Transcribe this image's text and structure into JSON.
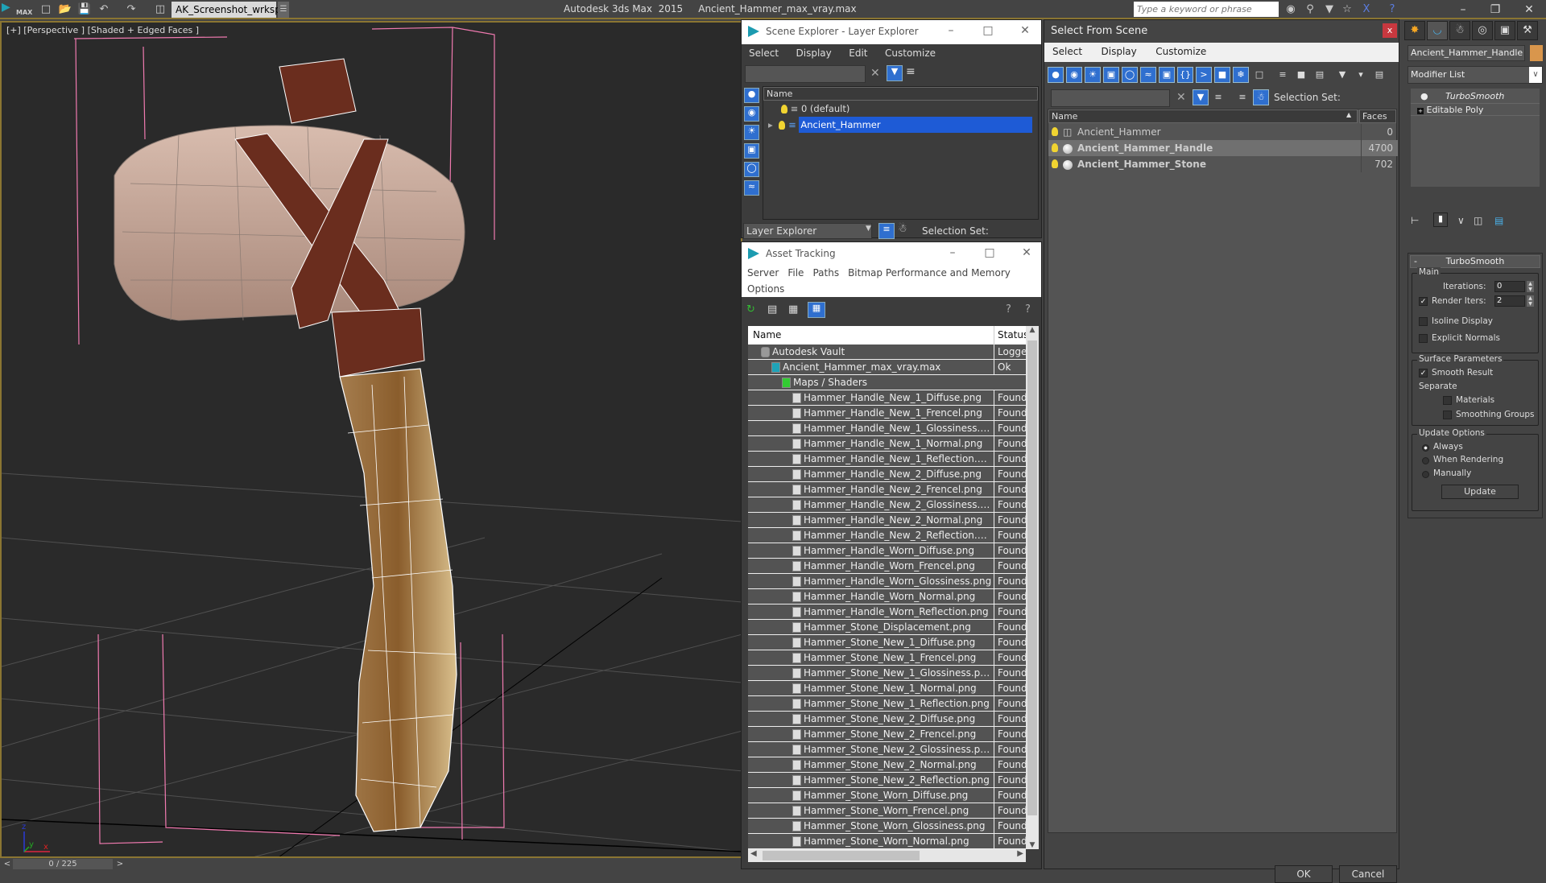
{
  "app": {
    "logo": "MAX",
    "workspace": "AK_Screenshot_wrksp",
    "title": "Autodesk 3ds Max  2015     Ancient_Hammer_max_vray.max",
    "search_placeholder": "Type a keyword or phrase"
  },
  "viewport": {
    "label": "[+] [Perspective ] [Shaded + Edged Faces ]",
    "axis": {
      "x": "x",
      "y": "y",
      "z": "z"
    },
    "timeslider": "0 / 225",
    "prev": "<",
    "next": ">"
  },
  "scene_explorer": {
    "title": "Scene Explorer - Layer Explorer",
    "menu": [
      "Select",
      "Display",
      "Edit",
      "Customize"
    ],
    "column": "Name",
    "layers": [
      {
        "name": "0 (default)",
        "selected": false
      },
      {
        "name": "Ancient_Hammer",
        "selected": true
      }
    ],
    "footer_dropdown": "Layer Explorer",
    "selection_set_label": "Selection Set:"
  },
  "asset_tracking": {
    "title": "Asset Tracking",
    "menu": [
      "Server",
      "File",
      "Paths",
      "Bitmap Performance and Memory",
      "Options"
    ],
    "columns": {
      "name": "Name",
      "status": "Status"
    },
    "rows": [
      {
        "name": "Autodesk Vault",
        "status": "Logged",
        "level": 0,
        "icon": "vault-icon"
      },
      {
        "name": "Ancient_Hammer_max_vray.max",
        "status": "Ok",
        "level": 1,
        "icon": "max-file-icon"
      },
      {
        "name": "Maps / Shaders",
        "status": "",
        "level": 2,
        "icon": "maps-folder-icon"
      },
      {
        "name": "Hammer_Handle_New_1_Diffuse.png",
        "status": "Found",
        "level": 3
      },
      {
        "name": "Hammer_Handle_New_1_Frencel.png",
        "status": "Found",
        "level": 3
      },
      {
        "name": "Hammer_Handle_New_1_Glossiness.p...",
        "status": "Found",
        "level": 3
      },
      {
        "name": "Hammer_Handle_New_1_Normal.png",
        "status": "Found",
        "level": 3
      },
      {
        "name": "Hammer_Handle_New_1_Reflection.p...",
        "status": "Found",
        "level": 3
      },
      {
        "name": "Hammer_Handle_New_2_Diffuse.png",
        "status": "Found",
        "level": 3
      },
      {
        "name": "Hammer_Handle_New_2_Frencel.png",
        "status": "Found",
        "level": 3
      },
      {
        "name": "Hammer_Handle_New_2_Glossiness.p...",
        "status": "Found",
        "level": 3
      },
      {
        "name": "Hammer_Handle_New_2_Normal.png",
        "status": "Found",
        "level": 3
      },
      {
        "name": "Hammer_Handle_New_2_Reflection.p...",
        "status": "Found",
        "level": 3
      },
      {
        "name": "Hammer_Handle_Worn_Diffuse.png",
        "status": "Found",
        "level": 3
      },
      {
        "name": "Hammer_Handle_Worn_Frencel.png",
        "status": "Found",
        "level": 3
      },
      {
        "name": "Hammer_Handle_Worn_Glossiness.png",
        "status": "Found",
        "level": 3
      },
      {
        "name": "Hammer_Handle_Worn_Normal.png",
        "status": "Found",
        "level": 3
      },
      {
        "name": "Hammer_Handle_Worn_Reflection.png",
        "status": "Found",
        "level": 3
      },
      {
        "name": "Hammer_Stone_Displacement.png",
        "status": "Found",
        "level": 3
      },
      {
        "name": "Hammer_Stone_New_1_Diffuse.png",
        "status": "Found",
        "level": 3
      },
      {
        "name": "Hammer_Stone_New_1_Frencel.png",
        "status": "Found",
        "level": 3
      },
      {
        "name": "Hammer_Stone_New_1_Glossiness.png",
        "status": "Found",
        "level": 3
      },
      {
        "name": "Hammer_Stone_New_1_Normal.png",
        "status": "Found",
        "level": 3
      },
      {
        "name": "Hammer_Stone_New_1_Reflection.png",
        "status": "Found",
        "level": 3
      },
      {
        "name": "Hammer_Stone_New_2_Diffuse.png",
        "status": "Found",
        "level": 3
      },
      {
        "name": "Hammer_Stone_New_2_Frencel.png",
        "status": "Found",
        "level": 3
      },
      {
        "name": "Hammer_Stone_New_2_Glossiness.png",
        "status": "Found",
        "level": 3
      },
      {
        "name": "Hammer_Stone_New_2_Normal.png",
        "status": "Found",
        "level": 3
      },
      {
        "name": "Hammer_Stone_New_2_Reflection.png",
        "status": "Found",
        "level": 3
      },
      {
        "name": "Hammer_Stone_Worn_Diffuse.png",
        "status": "Found",
        "level": 3
      },
      {
        "name": "Hammer_Stone_Worn_Frencel.png",
        "status": "Found",
        "level": 3
      },
      {
        "name": "Hammer_Stone_Worn_Glossiness.png",
        "status": "Found",
        "level": 3
      },
      {
        "name": "Hammer_Stone_Worn_Normal.png",
        "status": "Found",
        "level": 3
      }
    ]
  },
  "select_from_scene": {
    "title": "Select From Scene",
    "close": "x",
    "menu": [
      "Select",
      "Display",
      "Customize"
    ],
    "selection_set_label": "Selection Set:",
    "columns": {
      "name": "Name",
      "faces": "Faces"
    },
    "objects": [
      {
        "name": "Ancient_Hammer",
        "faces": "0",
        "bold": false,
        "selected": false,
        "icon": "group-icon"
      },
      {
        "name": "Ancient_Hammer_Handle",
        "faces": "4700",
        "bold": true,
        "selected": true,
        "icon": "geometry-icon"
      },
      {
        "name": "Ancient_Hammer_Stone",
        "faces": "702",
        "bold": true,
        "selected": false,
        "icon": "geometry-icon"
      }
    ],
    "ok": "OK",
    "cancel": "Cancel"
  },
  "command_panel": {
    "object_name": "Ancient_Hammer_Handle",
    "object_color": "#d9964c",
    "modifier_list": "Modifier List",
    "stack": [
      "TurboSmooth",
      "Editable Poly"
    ],
    "rollout": {
      "title": "TurboSmooth",
      "collapse": "-",
      "main_label": "Main",
      "iterations_label": "Iterations:",
      "iterations": "0",
      "render_iters_label": "Render Iters:",
      "render_iters": "2",
      "render_iters_checked": true,
      "isoline_label": "Isoline Display",
      "isoline_checked": false,
      "explicit_normals_label": "Explicit Normals",
      "explicit_normals_checked": false,
      "surface_label": "Surface Parameters",
      "smooth_result_label": "Smooth Result",
      "smooth_result_checked": true,
      "separate_label": "Separate",
      "materials_label": "Materials",
      "materials_checked": false,
      "smoothing_groups_label": "Smoothing Groups",
      "smoothing_groups_checked": false,
      "update_options_label": "Update Options",
      "update_options": [
        "Always",
        "When Rendering",
        "Manually"
      ],
      "update_selected": "Always",
      "update_button": "Update"
    }
  },
  "colors": {
    "accent_blue": "#2f6fcf",
    "selection_blue": "#1e5bd6",
    "frame_gold": "#8a7532",
    "close_red": "#c8383f"
  }
}
